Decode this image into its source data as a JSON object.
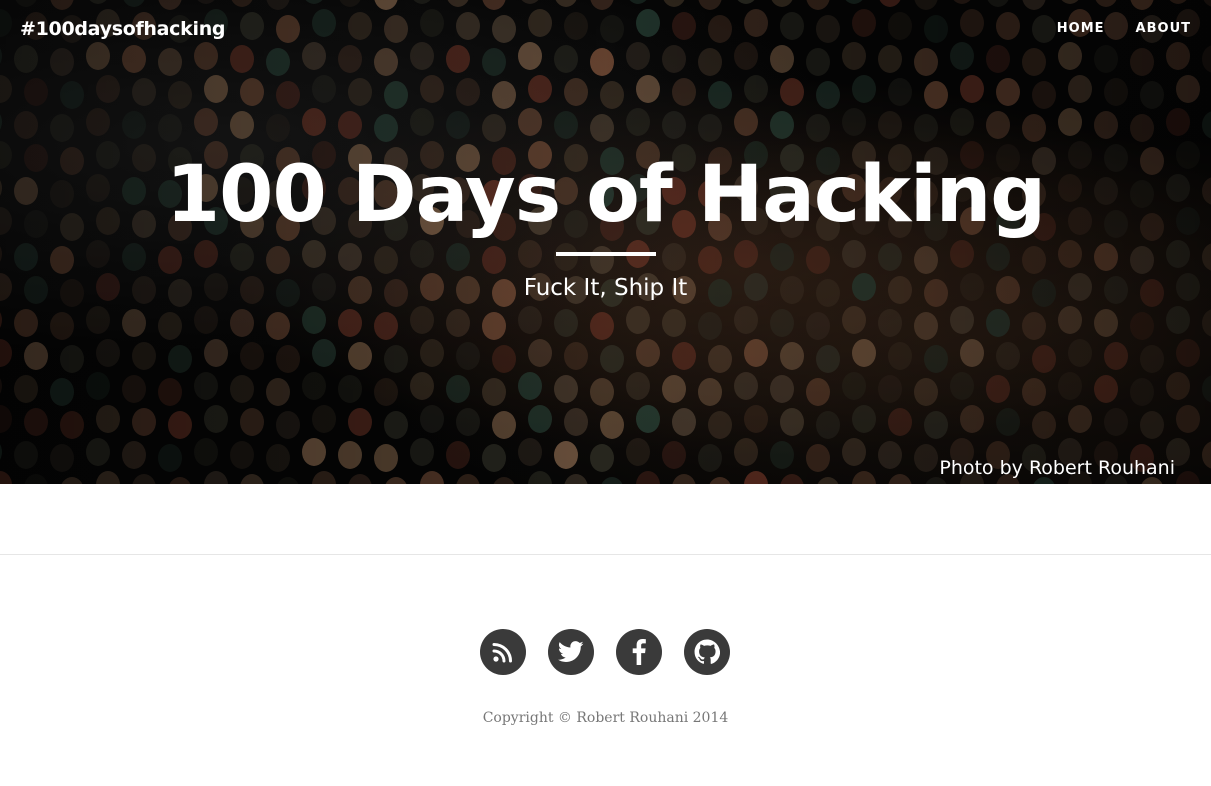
{
  "navbar": {
    "brand": "#100daysofhacking",
    "links": [
      {
        "label": "HOME"
      },
      {
        "label": "ABOUT"
      }
    ]
  },
  "hero": {
    "title": "100 Days of Hacking",
    "subtitle": "Fuck It, Ship It",
    "photo_credit": "Photo by Robert Rouhani"
  },
  "footer": {
    "social": [
      {
        "icon": "rss-icon"
      },
      {
        "icon": "twitter-icon"
      },
      {
        "icon": "facebook-icon"
      },
      {
        "icon": "github-icon"
      }
    ],
    "copyright": "Copyright © Robert Rouhani 2014"
  },
  "colors": {
    "hero_background": "#050505",
    "text_on_hero": "#ffffff",
    "social_circle": "#3a3a3a",
    "copyright_text": "#777777"
  }
}
